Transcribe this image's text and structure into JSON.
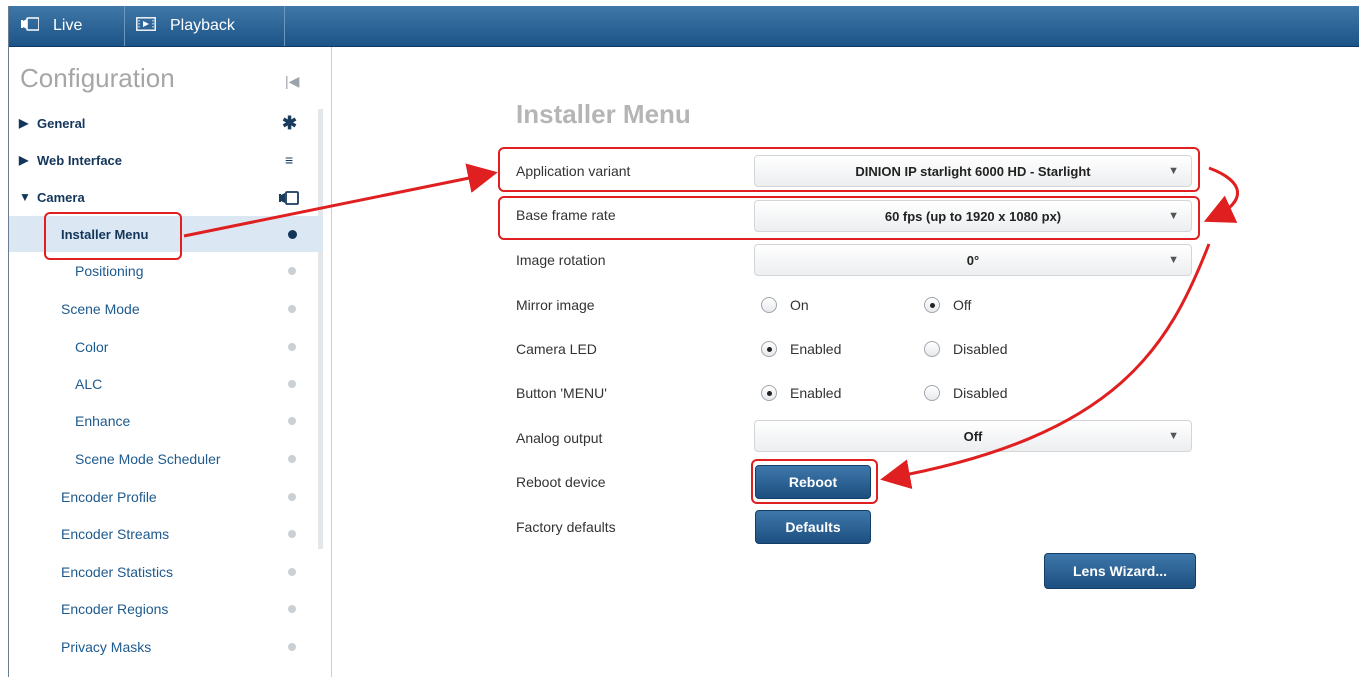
{
  "topbar": {
    "tabs": [
      {
        "label": "Live",
        "icon": "camera-icon"
      },
      {
        "label": "Playback",
        "icon": "playback-icon"
      }
    ],
    "bg_color": "#2a6196"
  },
  "sidebar": {
    "title": "Configuration",
    "items": [
      {
        "label": "General",
        "expander": "▶",
        "icon": "gear-icon"
      },
      {
        "label": "Web Interface",
        "expander": "▶",
        "icon": "menu-icon"
      },
      {
        "label": "Camera",
        "expander": "▼",
        "icon": "camera-icon"
      },
      {
        "label": "Installer Menu"
      },
      {
        "label": "Positioning"
      },
      {
        "label": "Scene Mode"
      },
      {
        "label": "Color"
      },
      {
        "label": "ALC"
      },
      {
        "label": "Enhance"
      },
      {
        "label": "Scene Mode Scheduler"
      },
      {
        "label": "Encoder Profile"
      },
      {
        "label": "Encoder Streams"
      },
      {
        "label": "Encoder Statistics"
      },
      {
        "label": "Encoder Regions"
      },
      {
        "label": "Privacy Masks"
      }
    ]
  },
  "main": {
    "title": "Installer Menu",
    "application_variant": {
      "label": "Application variant",
      "value": "DINION IP starlight 6000 HD - Starlight"
    },
    "base_frame_rate": {
      "label": "Base frame rate",
      "value": "60 fps (up to 1920 x 1080 px)"
    },
    "image_rotation": {
      "label": "Image rotation",
      "value": "0°"
    },
    "mirror_image": {
      "label": "Mirror image",
      "options": [
        "On",
        "Off"
      ],
      "selected": "Off"
    },
    "camera_led": {
      "label": "Camera LED",
      "options": [
        "Enabled",
        "Disabled"
      ],
      "selected": "Enabled"
    },
    "button_menu": {
      "label": "Button 'MENU'",
      "options": [
        "Enabled",
        "Disabled"
      ],
      "selected": "Enabled"
    },
    "analog_output": {
      "label": "Analog output",
      "value": "Off"
    },
    "reboot": {
      "label": "Reboot device",
      "button": "Reboot"
    },
    "factory": {
      "label": "Factory defaults",
      "button": "Defaults"
    },
    "lens_wizard_button": "Lens Wizard..."
  },
  "annotation_color": "#e02020"
}
